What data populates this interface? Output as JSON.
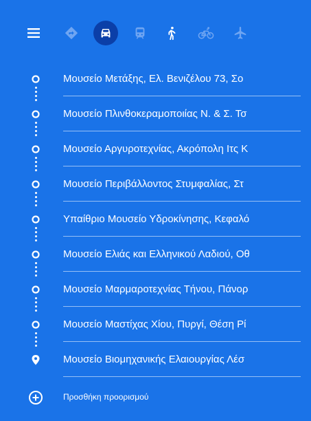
{
  "colors": {
    "panel_background": "#1a73e8",
    "active_mode_background": "#0b3fa8",
    "inactive_icon": "#6fa5f2",
    "text": "#ffffff"
  },
  "modes": [
    {
      "icon": "directions-best-icon",
      "active": false
    },
    {
      "icon": "car-icon",
      "active": true
    },
    {
      "icon": "transit-icon",
      "active": false
    },
    {
      "icon": "walk-icon",
      "active": false
    },
    {
      "icon": "bicycle-icon",
      "active": false
    },
    {
      "icon": "flight-icon",
      "active": false
    }
  ],
  "stops": [
    "Μουσείο Μετάξης, Ελ. Βενιζέλου 73, Σο",
    "Μουσείο Πλινθοκεραμοποιίας Ν. & Σ. Τσ",
    "Μουσείο Αργυροτεχνίας, Ακρόπολη Ιτς Κ",
    "Μουσείο Περιβάλλοντος Στυμφαλίας, Στ",
    "Υπαίθριο Μουσείο Υδροκίνησης, Κεφαλό",
    "Μουσείο Ελιάς και Ελληνικού Λαδιού, Οθ",
    "Μουσείο Μαρμαροτεχνίας Τήνου, Πάνορ",
    "Μουσείο Μαστίχας Χίου, Πυργί, Θέση Ρί",
    "Μουσείο Βιομηχανικής Ελαιουργίας Λέσ"
  ],
  "add_destination": {
    "label": "Προσθήκη προορισμού",
    "icon": "add-circle-icon"
  },
  "menu_icon": "menu-icon"
}
